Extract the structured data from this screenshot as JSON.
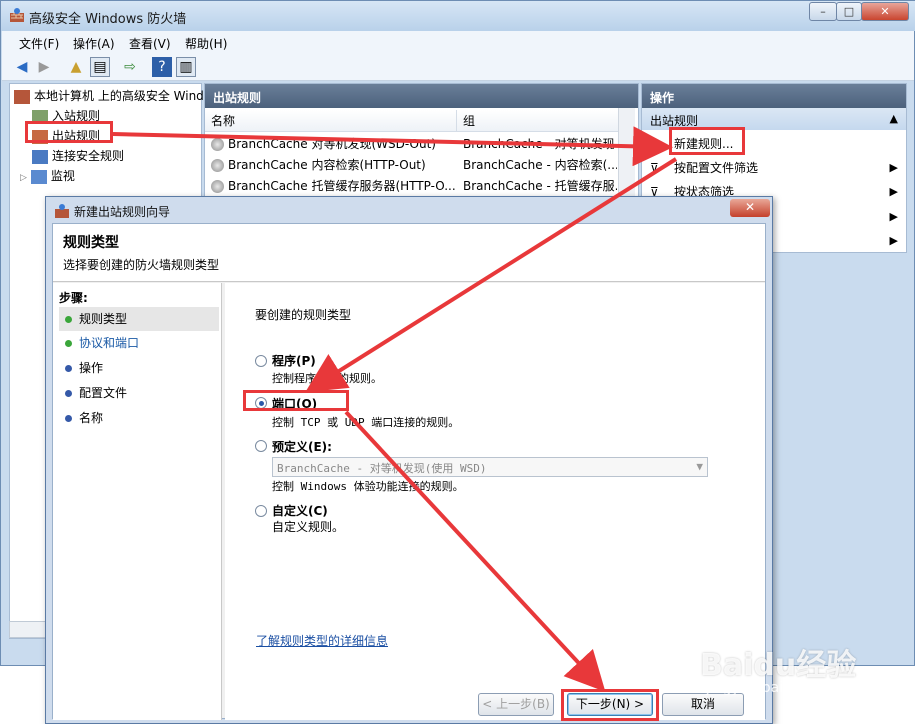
{
  "window": {
    "title": "高级安全 Windows 防火墙",
    "controls": [
      "–",
      "□",
      "✕"
    ]
  },
  "menu": [
    "文件(F)",
    "操作(A)",
    "查看(V)",
    "帮助(H)"
  ],
  "tree": {
    "root": "本地计算机 上的高级安全 Wind",
    "items": [
      "入站规则",
      "出站规则",
      "连接安全规则",
      "监视"
    ]
  },
  "rules_panel": {
    "header": "出站规则",
    "columns": [
      "名称",
      "组"
    ],
    "rows": [
      {
        "name": "BranchCache 对等机发现(WSD-Out)",
        "group": "BranchCache - 对等机发现"
      },
      {
        "name": "BranchCache 内容检索(HTTP-Out)",
        "group": "BranchCache - 内容检索(..."
      },
      {
        "name": "BranchCache 托管缓存服务器(HTTP-O...",
        "group": "BranchCache - 托管缓存服..."
      }
    ]
  },
  "actions_panel": {
    "header": "操作",
    "section": "出站规则",
    "items": [
      "新建规则...",
      "按配置文件筛选",
      "按状态筛选"
    ]
  },
  "wizard": {
    "title": "新建出站规则向导",
    "heading": "规则类型",
    "subheading": "选择要创建的防火墙规则类型",
    "steps_label": "步骤:",
    "steps": [
      "规则类型",
      "协议和端口",
      "操作",
      "配置文件",
      "名称"
    ],
    "prompt": "要创建的规则类型",
    "options": [
      {
        "label": "程序(P)",
        "desc": "控制程序连接的规则。",
        "selected": false
      },
      {
        "label": "端口(O)",
        "desc": "控制 TCP 或 UDP 端口连接的规则。",
        "selected": true
      },
      {
        "label": "预定义(E):",
        "desc": "控制 Windows 体验功能连接的规则。",
        "selected": false
      },
      {
        "label": "自定义(C)",
        "desc": "自定义规则。",
        "selected": false
      }
    ],
    "predefined_value": "BranchCache - 对等机发现(使用 WSD)",
    "learn_more": "了解规则类型的详细信息",
    "buttons": {
      "back": "< 上一步(B)",
      "next": "下一步(N) >",
      "cancel": "取消"
    }
  },
  "watermark": {
    "brand": "Baidu经验",
    "url": "jingyan.baidu.com"
  },
  "colors": {
    "annotation_red": "#e8383a",
    "title_blue": "#4c617c"
  }
}
